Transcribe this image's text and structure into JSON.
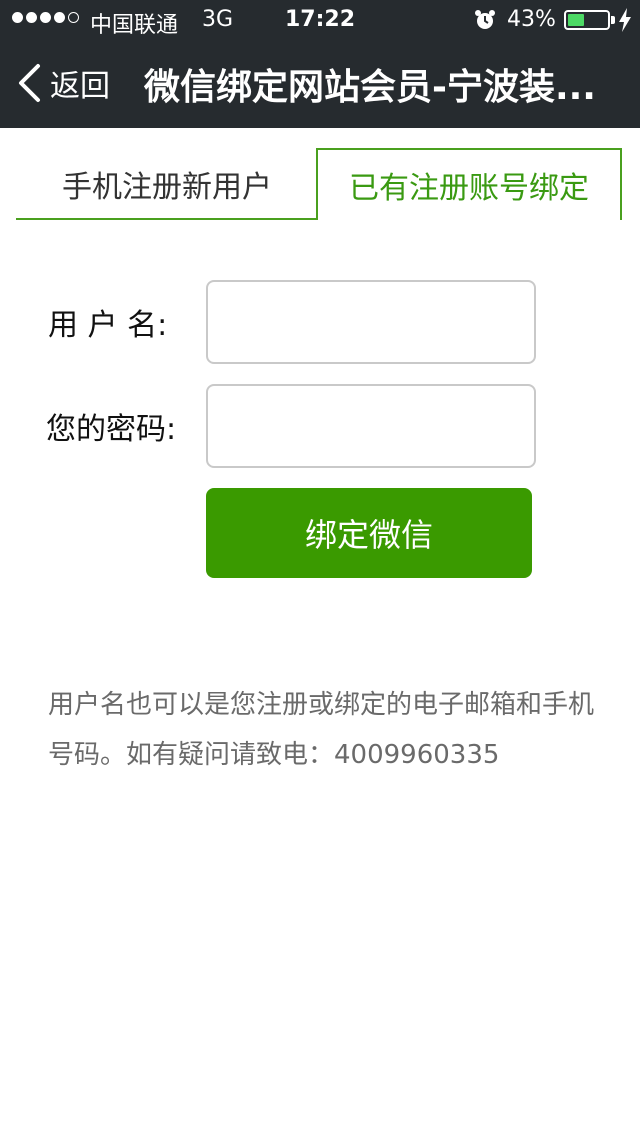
{
  "status_bar": {
    "carrier": "中国联通",
    "network": "3G",
    "time": "17:22",
    "battery_percent": "43%",
    "battery_level": 0.43
  },
  "nav": {
    "back_label": "返回",
    "title": "微信绑定网站会员-宁波装..."
  },
  "tabs": [
    {
      "label": "手机注册新用户",
      "active": false
    },
    {
      "label": "已有注册账号绑定",
      "active": true
    }
  ],
  "form": {
    "username_label": "用 户 名:",
    "password_label": "您的密码:",
    "username_value": "",
    "password_value": "",
    "submit_label": "绑定微信"
  },
  "help_text": "用户名也可以是您注册或绑定的电子邮箱和手机号码。如有疑问请致电：4009960335",
  "colors": {
    "header_bg": "#262b2f",
    "accent": "#3a9a00",
    "battery_fill": "#4cd964"
  }
}
